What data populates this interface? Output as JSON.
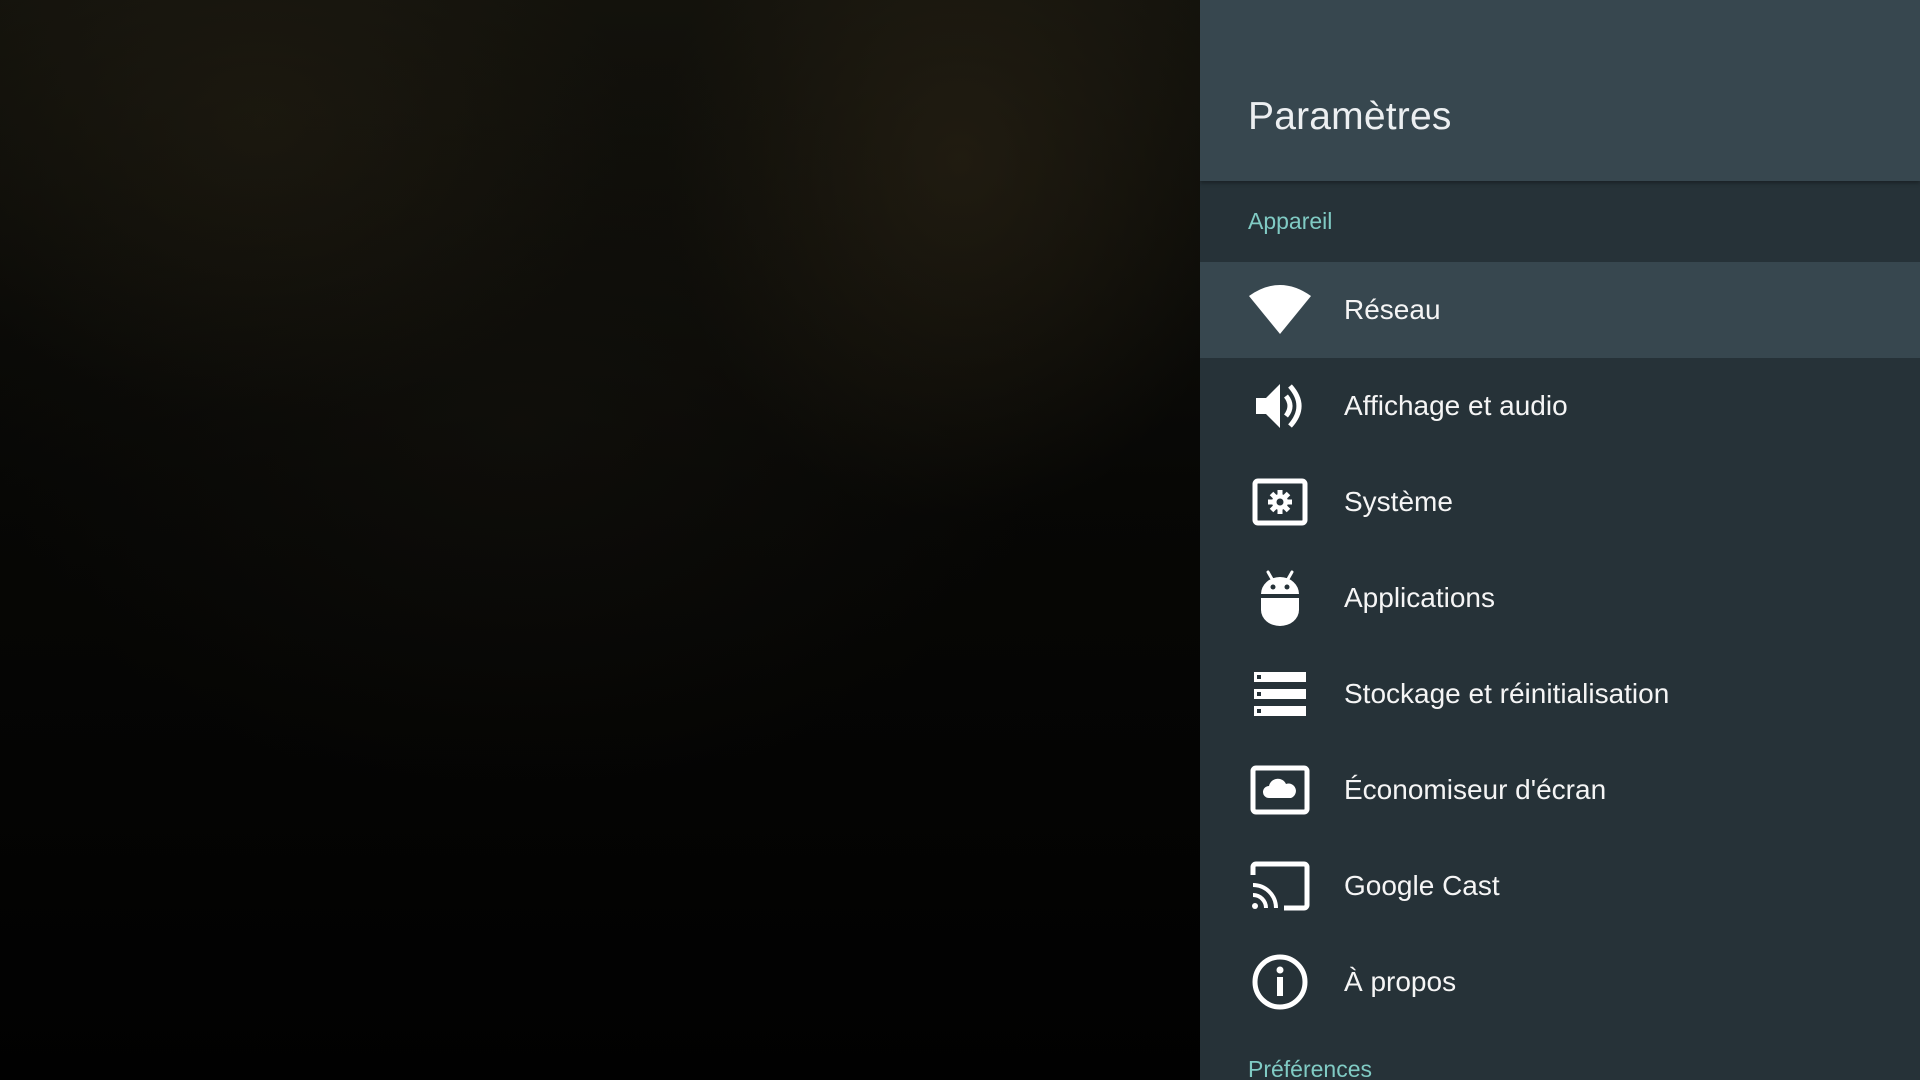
{
  "settings": {
    "title": "Paramètres",
    "sections": {
      "device": "Appareil",
      "preferences": "Préférences"
    },
    "items": [
      {
        "label": "Réseau",
        "icon": "wifi-icon",
        "focused": true
      },
      {
        "label": "Affichage et audio",
        "icon": "volume-icon",
        "focused": false
      },
      {
        "label": "Système",
        "icon": "system-settings-icon",
        "focused": false
      },
      {
        "label": "Applications",
        "icon": "android-icon",
        "focused": false
      },
      {
        "label": "Stockage et réinitialisation",
        "icon": "storage-icon",
        "focused": false
      },
      {
        "label": "Économiseur d'écran",
        "icon": "screensaver-icon",
        "focused": false
      },
      {
        "label": "Google Cast",
        "icon": "cast-icon",
        "focused": false
      },
      {
        "label": "À propos",
        "icon": "info-icon",
        "focused": false
      }
    ]
  },
  "colors": {
    "panel_bg": "#263238",
    "header_bg": "#37474f",
    "focused_bg": "#37474f",
    "section_accent": "#80cbc4",
    "text": "#f5f5f5"
  }
}
